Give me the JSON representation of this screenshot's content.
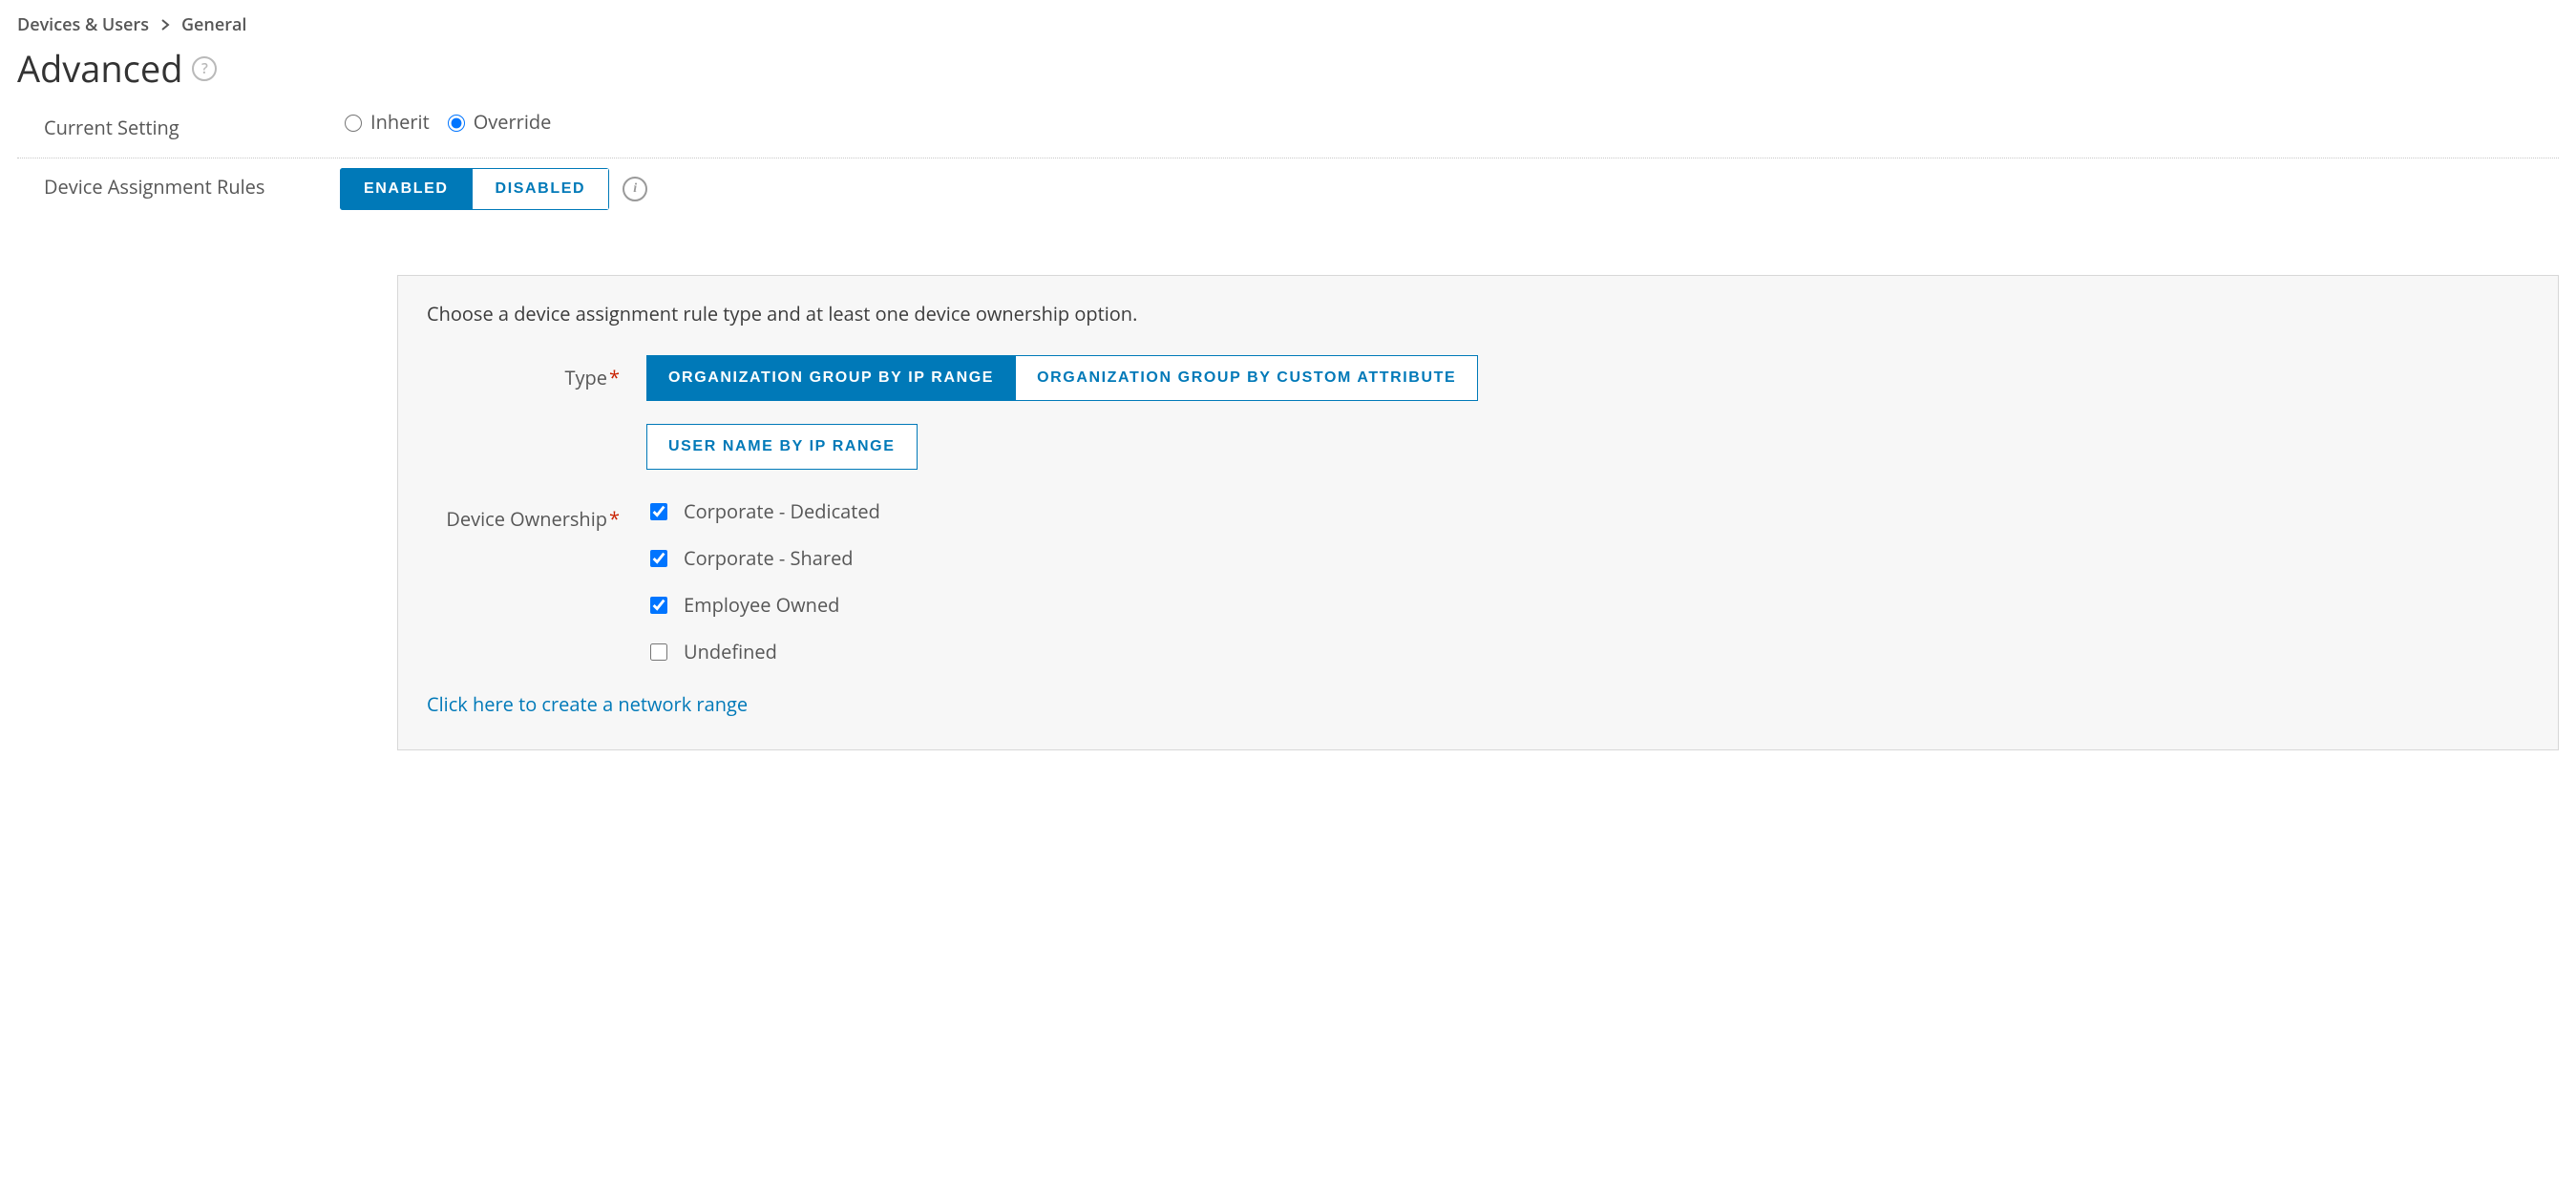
{
  "breadcrumb": {
    "items": [
      "Devices & Users",
      "General"
    ]
  },
  "page": {
    "title": "Advanced"
  },
  "currentSetting": {
    "label": "Current Setting",
    "options": {
      "inherit": "Inherit",
      "override": "Override"
    },
    "selected": "override"
  },
  "deviceAssignmentRules": {
    "label": "Device Assignment Rules",
    "enabledLabel": "ENABLED",
    "disabledLabel": "DISABLED",
    "enabled": true
  },
  "panel": {
    "intro": "Choose a device assignment rule type and at least one device ownership option.",
    "typeLabel": "Type",
    "typeOptions": [
      {
        "label": "ORGANIZATION GROUP BY IP RANGE",
        "selected": true
      },
      {
        "label": "ORGANIZATION GROUP BY CUSTOM ATTRIBUTE",
        "selected": false
      },
      {
        "label": "USER NAME BY IP RANGE",
        "selected": false
      }
    ],
    "ownershipLabel": "Device Ownership",
    "ownershipOptions": [
      {
        "label": "Corporate - Dedicated",
        "checked": true
      },
      {
        "label": "Corporate - Shared",
        "checked": true
      },
      {
        "label": "Employee Owned",
        "checked": true
      },
      {
        "label": "Undefined",
        "checked": false
      }
    ],
    "link": "Click here to create a network range"
  }
}
